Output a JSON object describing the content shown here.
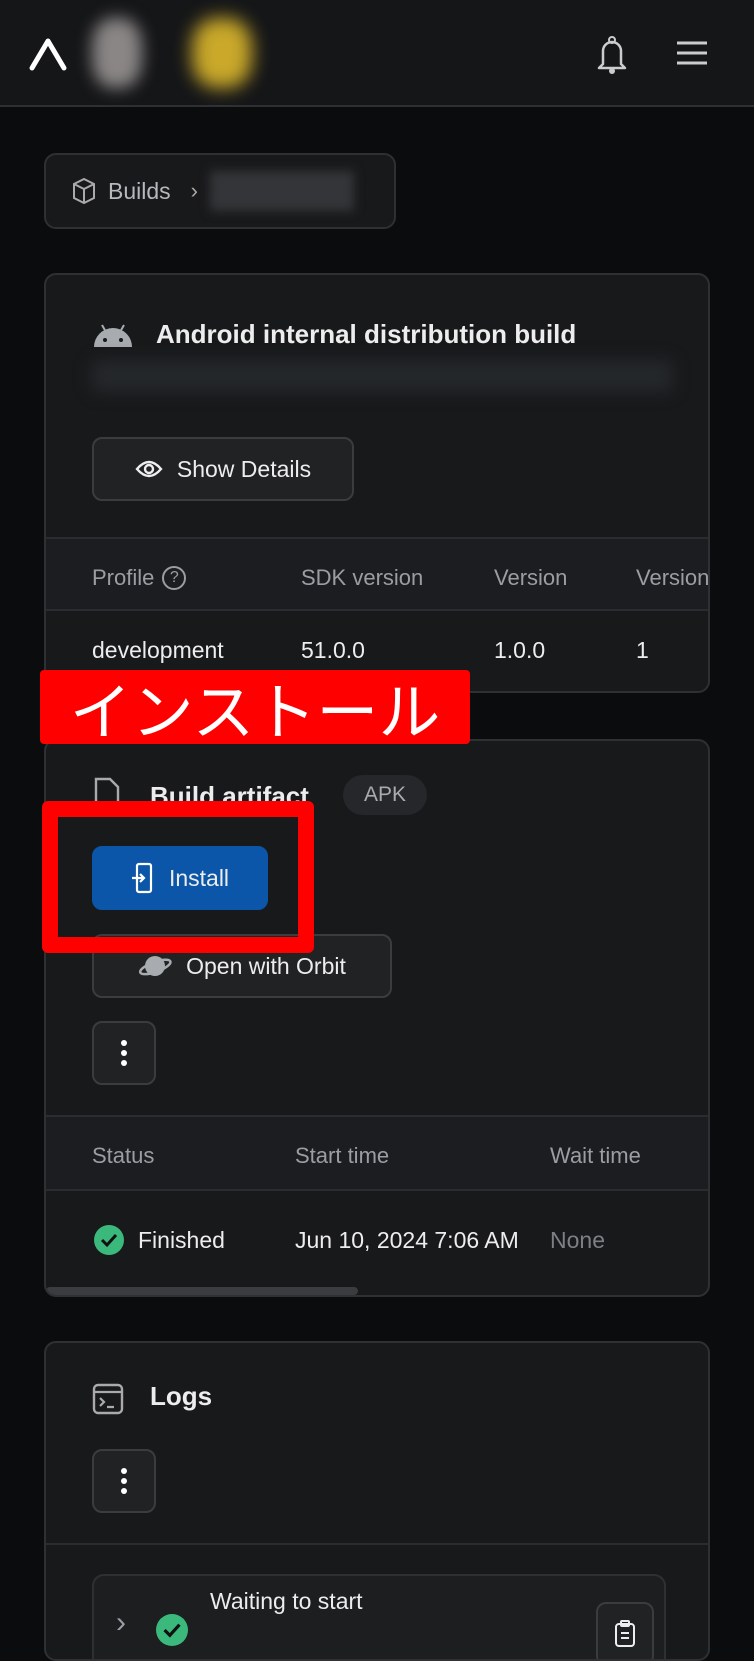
{
  "header": {
    "logo": "expo-logo",
    "bell_icon": "bell-icon",
    "menu_icon": "hamburger-icon"
  },
  "breadcrumb": {
    "root": "Builds"
  },
  "build": {
    "title": "Android internal distribution build",
    "show_details": "Show Details",
    "table": {
      "headers": [
        "Profile",
        "SDK version",
        "Version",
        "Version"
      ],
      "row": [
        "development",
        "51.0.0",
        "1.0.0",
        "1"
      ]
    }
  },
  "annotation": {
    "label": "インストール",
    "color": "#ff0000"
  },
  "artifact": {
    "title": "Build artifact",
    "badge": "APK",
    "install": "Install",
    "orbit": "Open with Orbit",
    "accent": "#0b56a8",
    "table": {
      "headers": [
        "Status",
        "Start time",
        "Wait time"
      ],
      "row": {
        "status": "Finished",
        "start": "Jun 10, 2024 7:06 AM",
        "wait": "None"
      }
    }
  },
  "logs": {
    "title": "Logs",
    "items": [
      {
        "label": "Waiting to start"
      }
    ]
  },
  "colors": {
    "success": "#3bb97c"
  }
}
